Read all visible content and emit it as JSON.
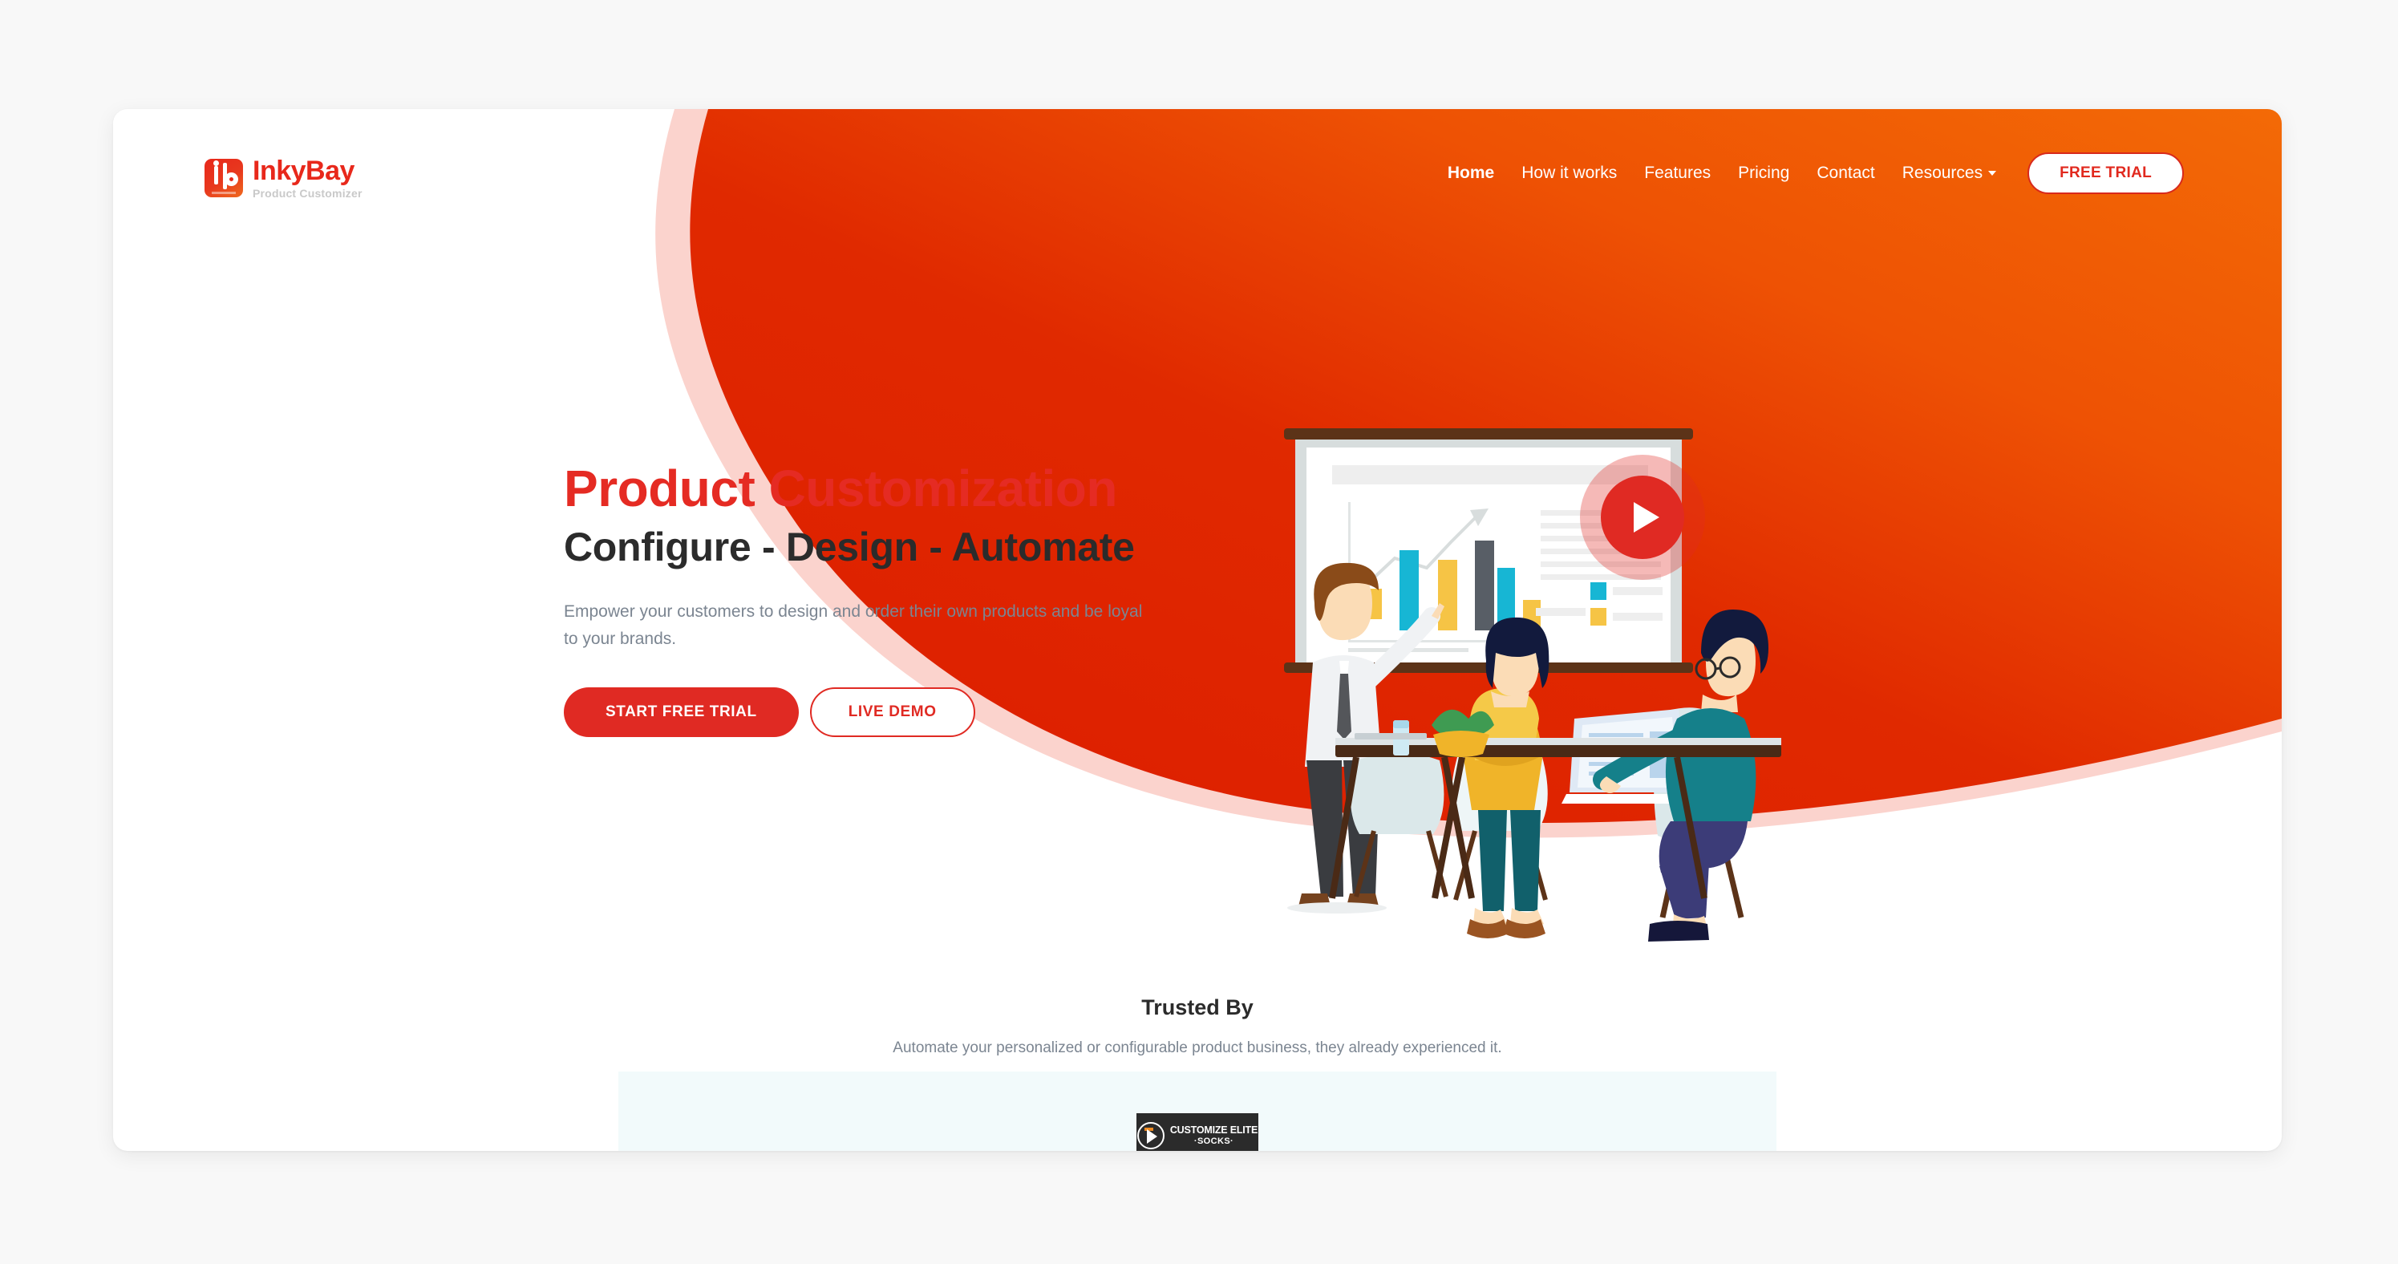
{
  "brand": {
    "name": "InkyBay",
    "tagline": "Product Customizer",
    "red": "#e52b23",
    "orange": "#f25c05",
    "blob_red": "#dd1c00",
    "pink_stroke": "#fbd3cd"
  },
  "nav": {
    "items": [
      {
        "label": "Home",
        "active": true,
        "has_caret": false
      },
      {
        "label": "How it works",
        "active": false,
        "has_caret": false
      },
      {
        "label": "Features",
        "active": false,
        "has_caret": false
      },
      {
        "label": "Pricing",
        "active": false,
        "has_caret": false
      },
      {
        "label": "Contact",
        "active": false,
        "has_caret": false
      },
      {
        "label": "Resources",
        "active": false,
        "has_caret": true
      }
    ],
    "cta_label": "FREE TRIAL"
  },
  "hero": {
    "title": "Product Customization",
    "subtitle": "Configure - Design - Automate",
    "description": "Empower your customers to design and order their own products and be loyal to your brands.",
    "primary_button": "START FREE TRIAL",
    "secondary_button": "LIVE DEMO",
    "play_button_label": "play-video"
  },
  "trusted": {
    "title": "Trusted By",
    "description": "Automate your personalized or configurable product business, they already experienced it.",
    "logos": [
      {
        "line1": "CUSTOMIZE ELITE",
        "line2": "·SOCKS·"
      }
    ]
  }
}
